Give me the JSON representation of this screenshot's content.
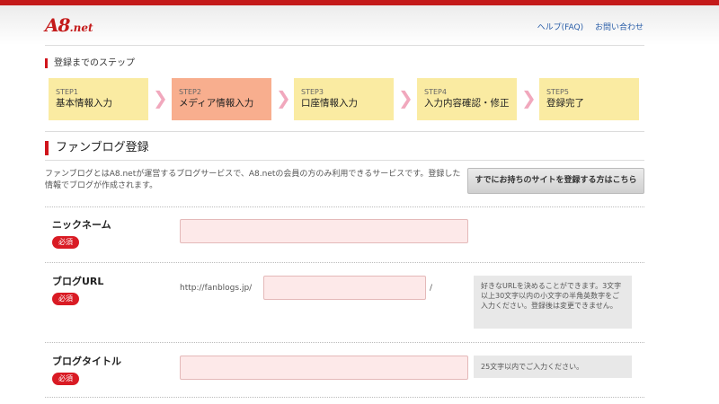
{
  "header": {
    "logo_main": "A8",
    "logo_suffix": ".net",
    "links": [
      "ヘルプ(FAQ)",
      "お問い合わせ"
    ]
  },
  "steps_section": {
    "label": "登録までのステップ",
    "steps": [
      {
        "num": "STEP1",
        "name": "基本情報入力"
      },
      {
        "num": "STEP2",
        "name": "メディア情報入力"
      },
      {
        "num": "STEP3",
        "name": "口座情報入力"
      },
      {
        "num": "STEP4",
        "name": "入力内容確認・修正"
      },
      {
        "num": "STEP5",
        "name": "登録完了"
      }
    ],
    "active_step": "STEP2"
  },
  "fanblog": {
    "title": "ファンブログ登録",
    "description": "ファンブログとはA8.netが運営するブログサービスで、A8.netの会員の方のみ利用できるサービスです。登録した情報でブログが作成されます。",
    "existing_site_button": "すでにお持ちのサイトを登録する方はこちら"
  },
  "form": {
    "required_badge": "必須",
    "nickname": {
      "label": "ニックネーム",
      "value": ""
    },
    "blog_url": {
      "label": "ブログURL",
      "prefix": "http://fanblogs.jp/",
      "suffix": "/",
      "value": "",
      "help": "好きなURLを決めることができます。3文字以上30文字以内の小文字の半角英数字をご入力ください。登録後は変更できません。"
    },
    "blog_title": {
      "label": "ブログタイトル",
      "value": "",
      "help": "25文字以内でご入力ください。"
    }
  },
  "colors": {
    "brand_red": "#d0141c",
    "step_inactive": "#faeba2",
    "step_active": "#f8ae8e",
    "input_bg": "#fde9e9"
  }
}
